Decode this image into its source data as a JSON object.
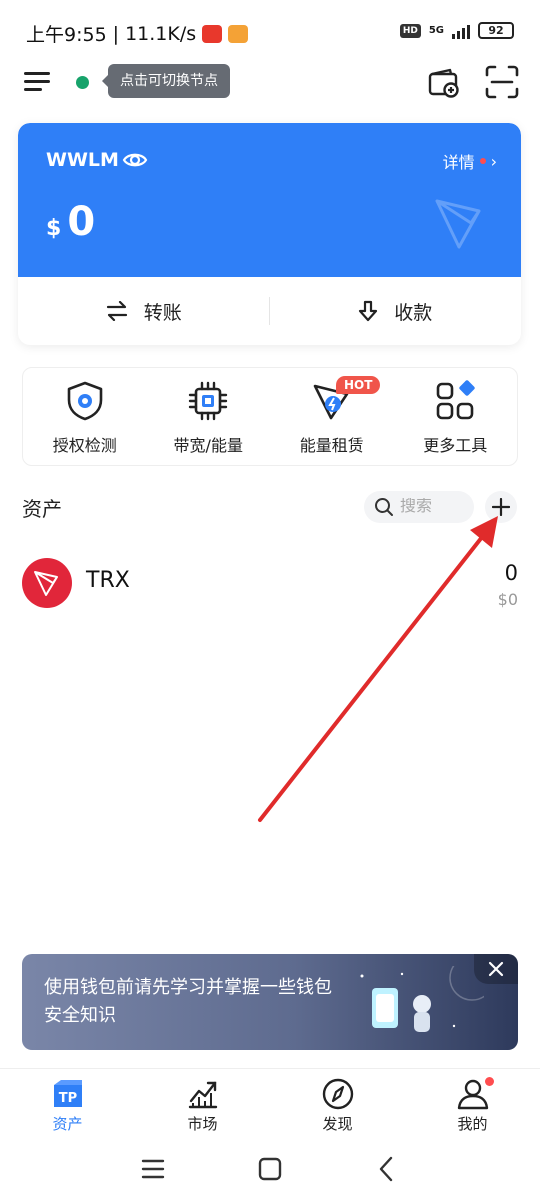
{
  "status_bar": {
    "time": "上午9:55",
    "speed": "11.1K/s",
    "hd": "HD",
    "network": "5G",
    "battery": "92"
  },
  "header": {
    "node_tooltip": "点击可切换节点"
  },
  "wallet": {
    "name": "WWLM",
    "detail_label": "详情",
    "currency_symbol": "$",
    "balance": "0",
    "transfer_label": "转账",
    "receive_label": "收款",
    "brand_color": "#2f7ff7"
  },
  "tools": [
    {
      "label": "授权检测",
      "icon": "shield-icon"
    },
    {
      "label": "带宽/能量",
      "icon": "chip-icon"
    },
    {
      "label": "能量租赁",
      "icon": "energy-rent-icon",
      "badge": "HOT"
    },
    {
      "label": "更多工具",
      "icon": "more-tools-icon"
    }
  ],
  "assets": {
    "title": "资产",
    "search_placeholder": "搜索",
    "tokens": [
      {
        "symbol": "TRX",
        "amount": "0",
        "value": "$0",
        "icon": "tron-icon",
        "color": "#e1263a"
      }
    ]
  },
  "banner": {
    "text": "使用钱包前请先学习并掌握一些钱包安全知识"
  },
  "bottom_nav": [
    {
      "label": "资产",
      "icon": "tp-wallet-icon",
      "active": true
    },
    {
      "label": "市场",
      "icon": "market-chart-icon"
    },
    {
      "label": "发现",
      "icon": "compass-icon"
    },
    {
      "label": "我的",
      "icon": "profile-icon"
    }
  ]
}
